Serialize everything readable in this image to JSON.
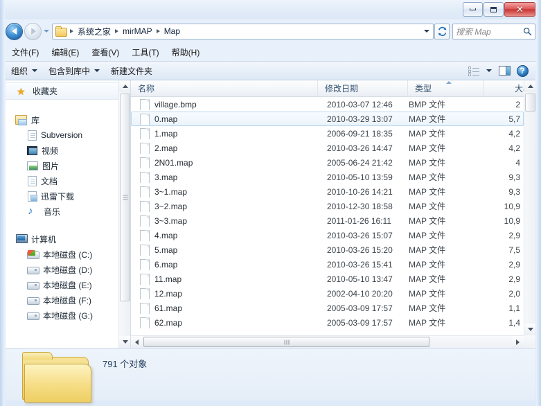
{
  "window": {
    "title": "Map",
    "buttons": {
      "minimize": "−",
      "maximize": "❐",
      "close": "✕"
    }
  },
  "nav": {
    "back_label": "后退",
    "forward_label": "前进",
    "recent_dropdown": "最近浏览的位置",
    "refresh_label": "刷新",
    "breadcrumb": [
      "系统之家",
      "mirMAP",
      "Map"
    ]
  },
  "search": {
    "placeholder": "搜索 Map",
    "value": "",
    "icon": "search-icon"
  },
  "menubar": {
    "items": [
      {
        "label": "文件(F)",
        "name": "file"
      },
      {
        "label": "编辑(E)",
        "name": "edit"
      },
      {
        "label": "查看(V)",
        "name": "view"
      },
      {
        "label": "工具(T)",
        "name": "tools"
      },
      {
        "label": "帮助(H)",
        "name": "help"
      }
    ]
  },
  "toolbar": {
    "organize": "组织",
    "include_in_library": "包含到库中",
    "new_folder": "新建文件夹",
    "view_icon": "list-view-icon",
    "view_caret": "chevron-down-icon",
    "preview_pane_icon": "preview-pane-icon",
    "help_icon": "help-icon",
    "help_glyph": "?"
  },
  "sidebar": {
    "favorites": {
      "label": "收藏夹",
      "icon": "star-icon"
    },
    "groups": [
      {
        "label": "库",
        "icon": "library-icon",
        "children": [
          {
            "label": "Subversion",
            "icon": "folder-doc-icon"
          },
          {
            "label": "视频",
            "icon": "video-icon"
          },
          {
            "label": "图片",
            "icon": "pictures-icon"
          },
          {
            "label": "文档",
            "icon": "documents-icon"
          },
          {
            "label": "迅雷下载",
            "icon": "downloads-icon"
          },
          {
            "label": "音乐",
            "icon": "music-icon"
          }
        ]
      },
      {
        "label": "计算机",
        "icon": "computer-icon",
        "children": [
          {
            "label": "本地磁盘 (C:)",
            "icon": "system-drive-icon"
          },
          {
            "label": "本地磁盘 (D:)",
            "icon": "drive-icon"
          },
          {
            "label": "本地磁盘 (E:)",
            "icon": "drive-icon"
          },
          {
            "label": "本地磁盘 (F:)",
            "icon": "drive-icon"
          },
          {
            "label": "本地磁盘 (G:)",
            "icon": "drive-icon"
          }
        ]
      }
    ]
  },
  "filelist": {
    "columns": [
      {
        "label": "名称",
        "name": "name"
      },
      {
        "label": "修改日期",
        "name": "date-modified"
      },
      {
        "label": "类型",
        "name": "type"
      },
      {
        "label": "大小",
        "name": "size"
      }
    ],
    "sort_column": "名称",
    "sort_direction": "ascending",
    "rows": [
      {
        "name": "village.bmp",
        "date": "2010-03-07 12:46",
        "type": "BMP 文件",
        "size": "2",
        "selected": false
      },
      {
        "name": "0.map",
        "date": "2010-03-29 13:07",
        "type": "MAP 文件",
        "size": "5,7",
        "selected": true
      },
      {
        "name": "1.map",
        "date": "2006-09-21 18:35",
        "type": "MAP 文件",
        "size": "4,2",
        "selected": false
      },
      {
        "name": "2.map",
        "date": "2010-03-26 14:47",
        "type": "MAP 文件",
        "size": "4,2",
        "selected": false
      },
      {
        "name": "2N01.map",
        "date": "2005-06-24 21:42",
        "type": "MAP 文件",
        "size": "4",
        "selected": false
      },
      {
        "name": "3.map",
        "date": "2010-05-10 13:59",
        "type": "MAP 文件",
        "size": "9,3",
        "selected": false
      },
      {
        "name": "3~1.map",
        "date": "2010-10-26 14:21",
        "type": "MAP 文件",
        "size": "9,3",
        "selected": false
      },
      {
        "name": "3~2.map",
        "date": "2010-12-30 18:58",
        "type": "MAP 文件",
        "size": "10,9",
        "selected": false
      },
      {
        "name": "3~3.map",
        "date": "2011-01-26 16:11",
        "type": "MAP 文件",
        "size": "10,9",
        "selected": false
      },
      {
        "name": "4.map",
        "date": "2010-03-26 15:07",
        "type": "MAP 文件",
        "size": "2,9",
        "selected": false
      },
      {
        "name": "5.map",
        "date": "2010-03-26 15:20",
        "type": "MAP 文件",
        "size": "7,5",
        "selected": false
      },
      {
        "name": "6.map",
        "date": "2010-03-26 15:41",
        "type": "MAP 文件",
        "size": "2,9",
        "selected": false
      },
      {
        "name": "11.map",
        "date": "2010-05-10 13:47",
        "type": "MAP 文件",
        "size": "2,9",
        "selected": false
      },
      {
        "name": "12.map",
        "date": "2002-04-10 20:20",
        "type": "MAP 文件",
        "size": "2,0",
        "selected": false
      },
      {
        "name": "61.map",
        "date": "2005-03-09 17:57",
        "type": "MAP 文件",
        "size": "1,1",
        "selected": false
      },
      {
        "name": "62.map",
        "date": "2005-03-09 17:57",
        "type": "MAP 文件",
        "size": "1,4",
        "selected": false
      }
    ]
  },
  "statusbar": {
    "item_count": "791 个对象",
    "folder_icon": "folder-icon"
  },
  "colors": {
    "accent": "#3d8fd4",
    "close_button": "#c83535",
    "selection": "#ebf4fc",
    "selection_border": "#b8d6ef",
    "folder_yellow": "#f3cd70"
  }
}
